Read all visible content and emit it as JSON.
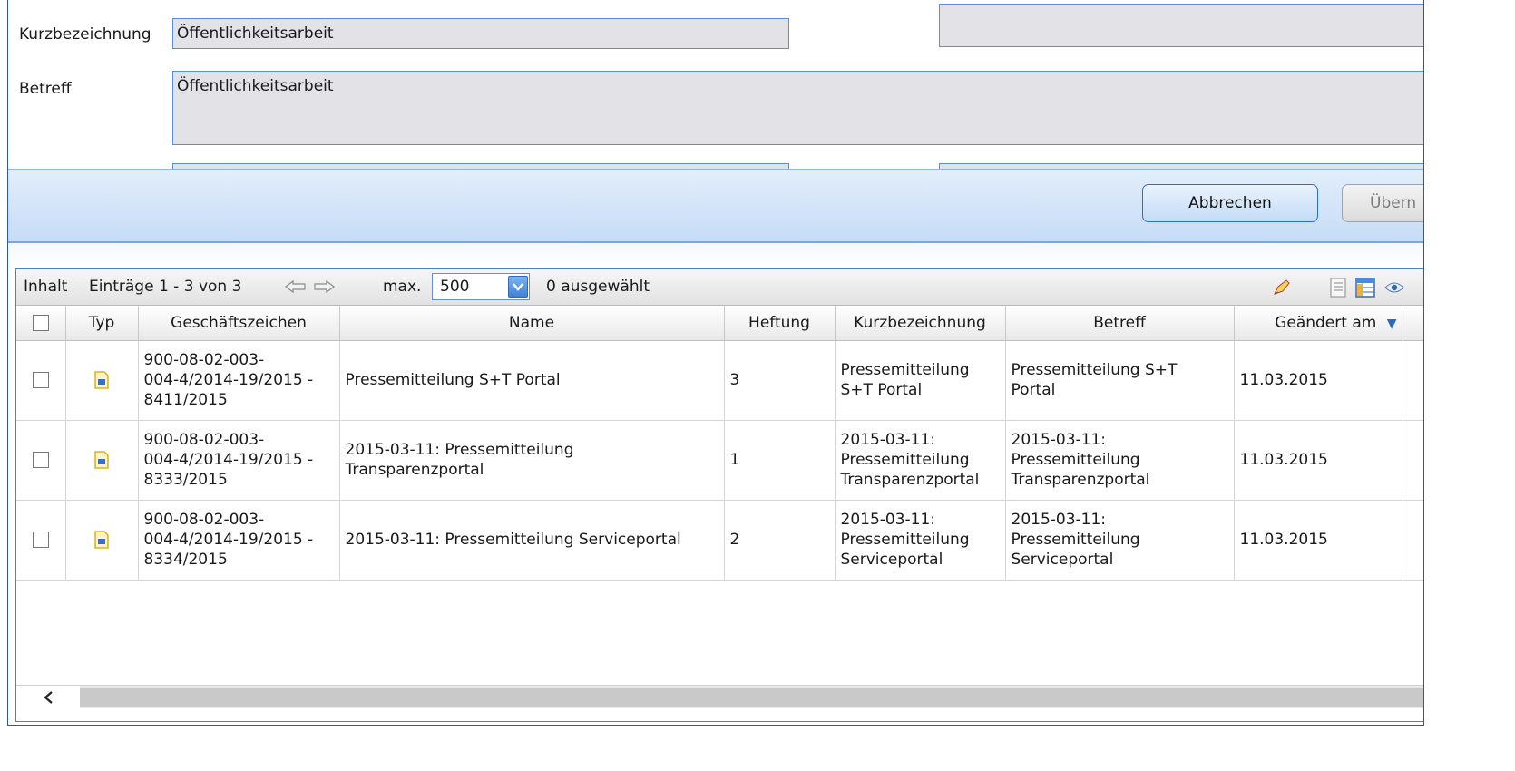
{
  "form": {
    "kurzbezeichnung_label": "Kurzbezeichnung",
    "kurzbezeichnung_value": "Öffentlichkeitsarbeit",
    "betreff_label": "Betreff",
    "betreff_value": "Öffentlichkeitsarbeit"
  },
  "toolbar": {
    "cancel_label": "Abbrechen",
    "apply_label": "Übern"
  },
  "grid_toolbar": {
    "section_label": "Inhalt",
    "entries_text": "Einträge 1 - 3 von 3",
    "max_label": "max.",
    "max_value": "500",
    "selected_text": "0 ausgewählt"
  },
  "table": {
    "columns": [
      "Typ",
      "Geschäftszeichen",
      "Name",
      "Heftung",
      "Kurzbezeichnung",
      "Betreff",
      "Geändert am"
    ],
    "sort_indicator": "▼",
    "rows": [
      {
        "geschaeftszeichen": [
          "900-08-02-003-",
          "004-4/2014-19/2015 -",
          "8411/2015"
        ],
        "name": [
          "Pressemitteilung S+T Portal"
        ],
        "heftung": "3",
        "kurzbezeichnung": [
          "Pressemitteilung",
          "S+T Portal"
        ],
        "betreff": [
          "Pressemitteilung S+T",
          "Portal"
        ],
        "geaendert_am": "11.03.2015"
      },
      {
        "geschaeftszeichen": [
          "900-08-02-003-",
          "004-4/2014-19/2015 -",
          "8333/2015"
        ],
        "name": [
          "2015-03-11: Pressemitteilung",
          "Transparenzportal"
        ],
        "heftung": "1",
        "kurzbezeichnung": [
          "2015-03-11:",
          "Pressemitteilung",
          "Transparenzportal"
        ],
        "betreff": [
          "2015-03-11:",
          "Pressemitteilung",
          "Transparenzportal"
        ],
        "geaendert_am": "11.03.2015"
      },
      {
        "geschaeftszeichen": [
          "900-08-02-003-",
          "004-4/2014-19/2015 -",
          "8334/2015"
        ],
        "name": [
          "2015-03-11: Pressemitteilung Serviceportal"
        ],
        "heftung": "2",
        "kurzbezeichnung": [
          "2015-03-11:",
          "Pressemitteilung",
          "Serviceportal"
        ],
        "betreff": [
          "2015-03-11:",
          "Pressemitteilung",
          "Serviceportal"
        ],
        "geaendert_am": "11.03.2015"
      }
    ]
  },
  "icons": {
    "document": "document-icon",
    "prev": "arrow-left-icon",
    "next": "arrow-right-icon",
    "scroll_left": "chevron-left-icon"
  },
  "colors": {
    "accent": "#2e6fc4",
    "field_bg": "#e2e2e7",
    "field_border": "#5b8ed6",
    "toolbar_bg": "#c6dcf6"
  }
}
